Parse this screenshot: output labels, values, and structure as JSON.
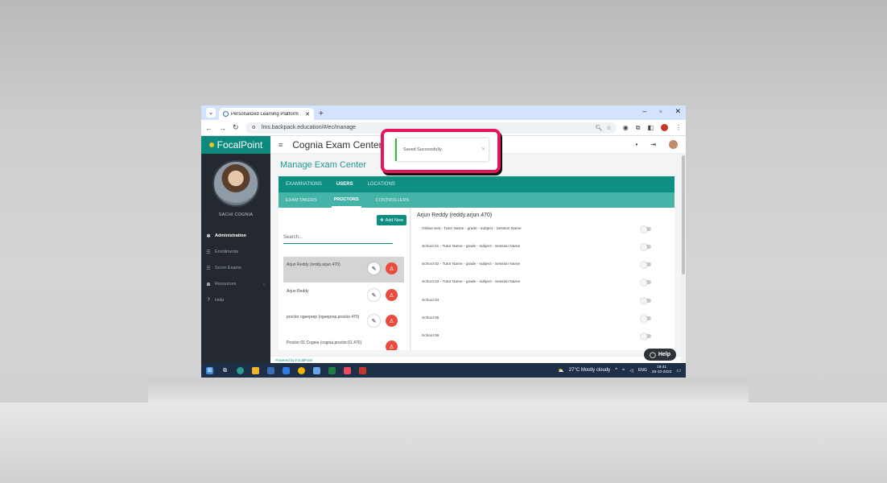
{
  "browser": {
    "tab_title": "Personalized Learning Platform",
    "url": "lms.backpack.education/#/ec/manage"
  },
  "app": {
    "brand": "FocalPoint",
    "title": "Cognia Exam Center",
    "page_title": "Manage Exam Center",
    "profile_name": "SACHI COGNIA"
  },
  "sidebar": {
    "items": [
      {
        "label": "Administration",
        "icon": "gear-icon"
      },
      {
        "label": "Enrollments",
        "icon": "list-icon"
      },
      {
        "label": "Score Exams",
        "icon": "list-icon"
      },
      {
        "label": "Resources",
        "icon": "users-icon"
      },
      {
        "label": "Help",
        "icon": "question-icon"
      }
    ]
  },
  "tabs": {
    "primary": [
      "EXAMINATIONS",
      "USERS",
      "LOCATIONS"
    ],
    "primary_active": "USERS",
    "secondary": [
      "EXAM TAKERS",
      "PROCTORS",
      "CONTROLLERS"
    ],
    "secondary_active": "PROCTORS"
  },
  "proctors_panel": {
    "add_label": "Add New",
    "search_placeholder": "Search...",
    "proctors": [
      "Arjun Reddy (reddy.arjun.470)",
      "Arjun  Reddy",
      "proctor ngeeprep (ngeeprep.proctor.470)",
      "Proctor 01 Cognia (cognia.proctor.01.470)"
    ]
  },
  "sessions_panel": {
    "heading": "Arjun Reddy (reddy.arjun.470)",
    "sessions": [
      "Online test - Tutor Name - grade - subject - Session Name",
      "School 01 - Tutor Name - grade - subject - Session Name",
      "School 02 - Tutor Name - grade - subject - Session Name",
      "School 03 - Tutor Name - grade - subject - Session Name",
      "School 04",
      "School 05",
      "School 06"
    ]
  },
  "footer": "Powered by FocalPoint",
  "help_label": "Help",
  "toast": {
    "message": "Saved Successfully."
  },
  "taskbar": {
    "weather": "27°C  Mostly cloudy",
    "lang": "ENG",
    "time": "19:41",
    "date": "26-10-2023"
  },
  "colors": {
    "accent": "#0e8f82",
    "accent_light": "#46b3a8",
    "danger": "#e74c3c",
    "highlight": "#e3175a",
    "success": "#3ab54a"
  }
}
